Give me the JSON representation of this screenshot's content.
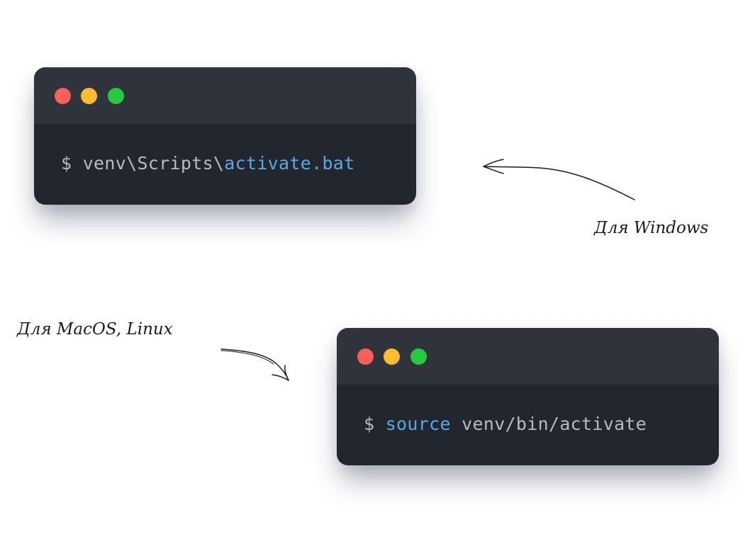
{
  "colors": {
    "dot_red": "#ff5f57",
    "dot_yellow": "#febc2e",
    "dot_green": "#28c840",
    "highlight": "#5aa9e6"
  },
  "terminals": [
    {
      "prompt": "$ ",
      "parts": [
        "venv\\Scripts\\",
        "activate.bat"
      ]
    },
    {
      "prompt": "$ ",
      "parts": [
        "source",
        " venv/bin/activate"
      ]
    }
  ],
  "annotations": {
    "windows": "Для Windows",
    "macos_linux": "Для MacOS, Linux"
  }
}
